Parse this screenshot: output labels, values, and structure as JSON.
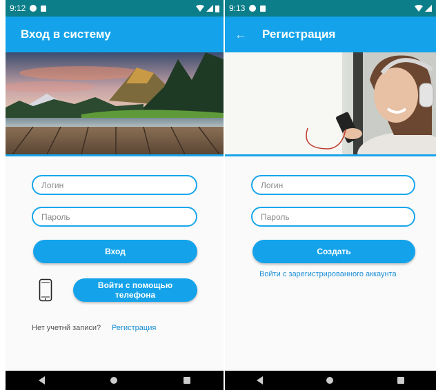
{
  "login_screen": {
    "status": {
      "time": "9:12"
    },
    "title": "Вход в систему",
    "login_placeholder": "Логин",
    "password_placeholder": "Пароль",
    "login_button": "Вход",
    "phone_button": "Войти с помощью телефона",
    "no_account_text": "Нет учетнй записи?",
    "register_link": "Регистрация",
    "hero_image": "mountain-lake-dock-landscape"
  },
  "register_screen": {
    "status": {
      "time": "9:13"
    },
    "back_icon": "arrow-left-icon",
    "title": "Регистрация",
    "login_placeholder": "Логин",
    "password_placeholder": "Пароль",
    "create_button": "Создать",
    "existing_account_link": "Войти с зарегистрированного аккаунта",
    "hero_image": "woman-with-headphones-photo"
  },
  "colors": {
    "status_bar": "#0c7e8a",
    "app_bar": "#14a3ea",
    "accent": "#14a3ea",
    "field_border": "#18a5ec",
    "link": "#1a8fd6",
    "nav_bar": "#000000"
  }
}
